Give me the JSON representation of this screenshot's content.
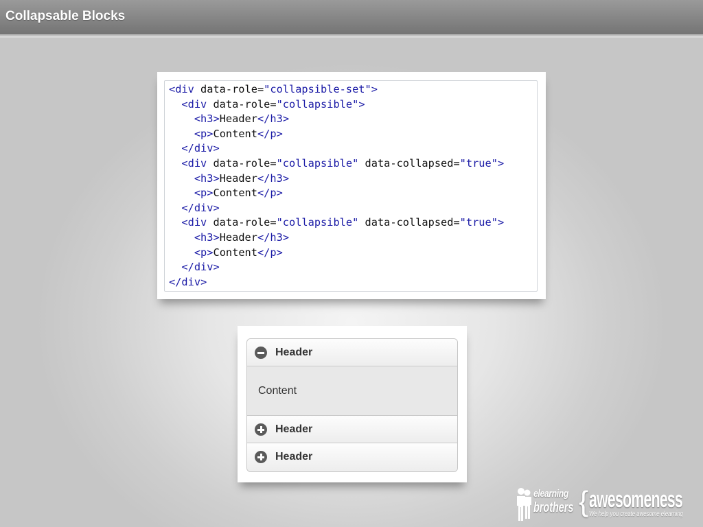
{
  "slide": {
    "title": "Collapsable Blocks"
  },
  "code_sample": {
    "lines": [
      "<div data-role=\"collapsible-set\">",
      "  <div data-role=\"collapsible\">",
      "    <h3>Header</h3>",
      "    <p>Content</p>",
      "  </div>",
      "  <div data-role=\"collapsible\" data-collapsed=\"true\">",
      "    <h3>Header</h3>",
      "    <p>Content</p>",
      "  </div>",
      "  <div data-role=\"collapsible\" data-collapsed=\"true\">",
      "    <h3>Header</h3>",
      "    <p>Content</p>",
      "  </div>",
      "</div>"
    ],
    "tag_color": "#1a1aa6"
  },
  "collapsible_demo": {
    "items": [
      {
        "header": "Header",
        "icon": "minus-circle-icon",
        "expanded": true,
        "content": "Content"
      },
      {
        "header": "Header",
        "icon": "plus-circle-icon",
        "expanded": false
      },
      {
        "header": "Header",
        "icon": "plus-circle-icon",
        "expanded": false
      }
    ]
  },
  "logo": {
    "line1": "elearning",
    "line2": "brothers",
    "brace": "{",
    "word": "awesomeness",
    "tagline": "We help you create awesome elearning"
  }
}
